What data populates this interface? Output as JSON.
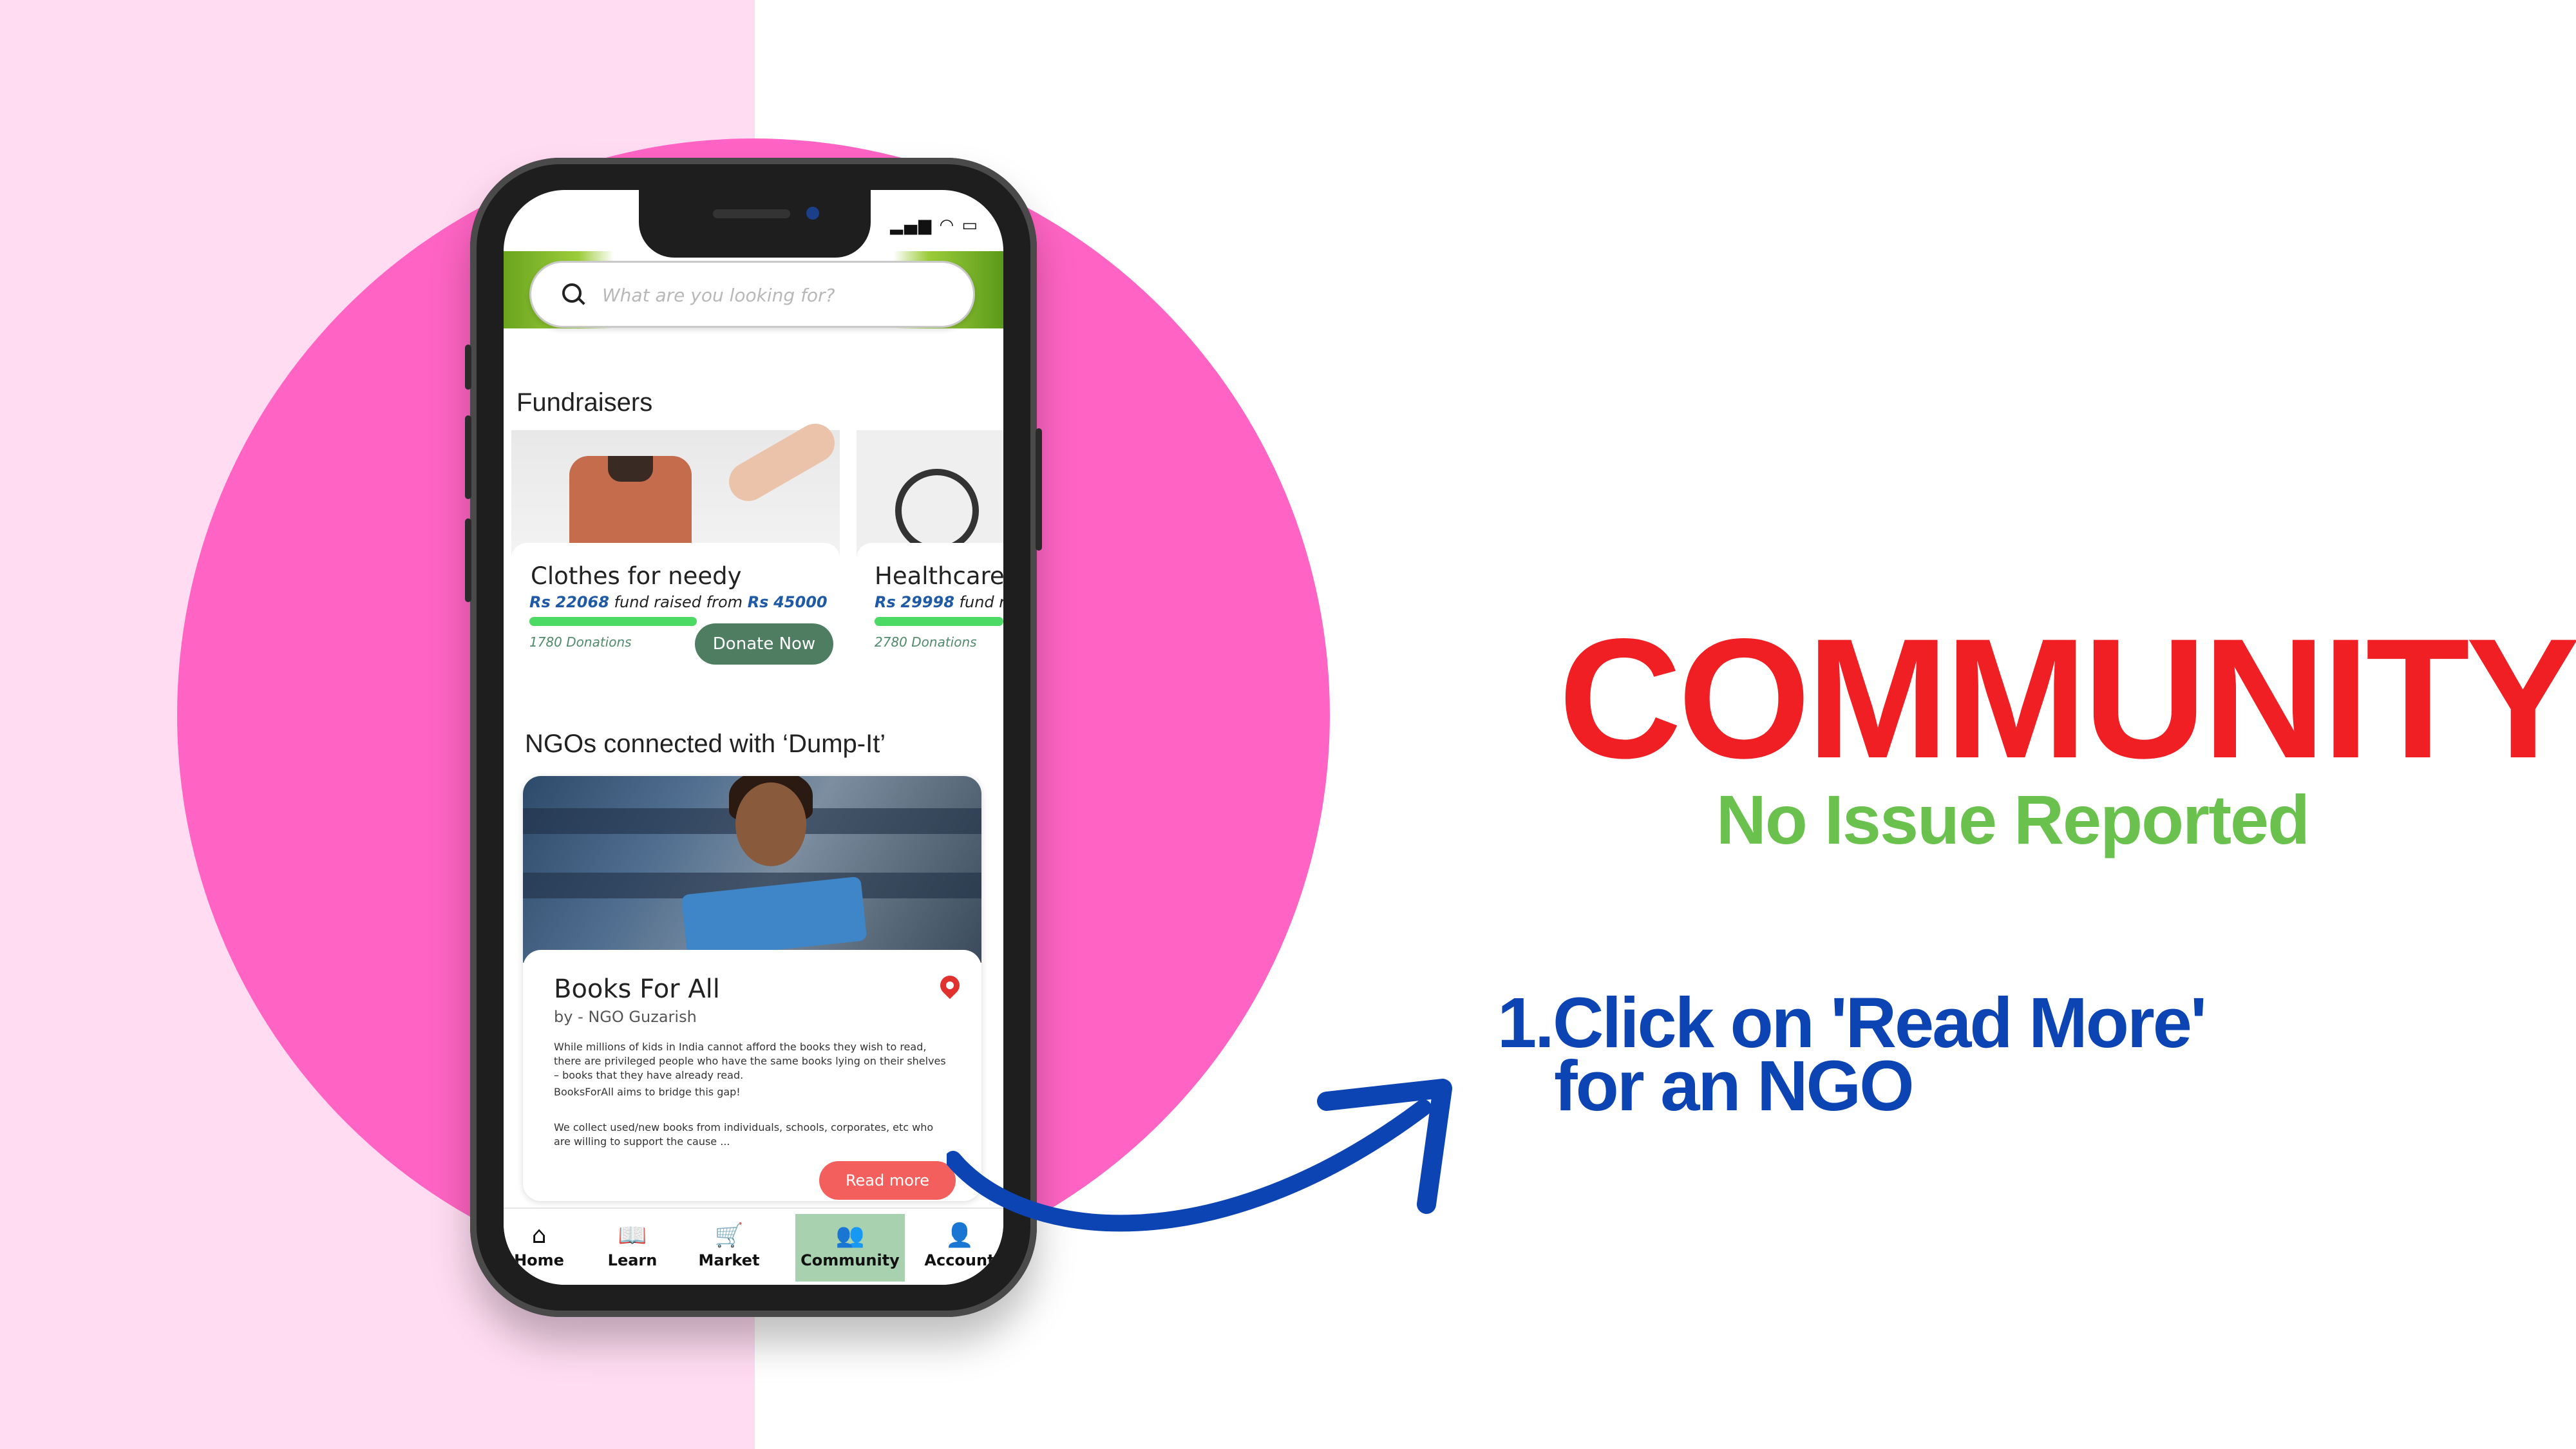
{
  "app": {
    "search": {
      "placeholder": "What are you looking for?"
    },
    "fundraisers": {
      "heading": "Fundraisers",
      "cards": [
        {
          "title": "Clothes for needy",
          "currency": "Rs",
          "raised": "22068",
          "raised_text": "fund raised from",
          "goal": "45000",
          "donations": "1780 Donations",
          "button": "Donate Now"
        },
        {
          "title": "Healthcare",
          "currency": "Rs",
          "raised": "29998",
          "raised_text": "fund ra",
          "donations": "2780 Donations"
        }
      ]
    },
    "ngos": {
      "heading": "NGOs connected with ‘Dump-It’",
      "card": {
        "title": "Books For All",
        "by": "by - NGO Guzarish",
        "desc1": "While millions of kids in India cannot afford the books they wish to read, there are privileged people who have the same books lying on their shelves – books that they have already read.",
        "desc2": "BooksForAll aims to bridge this gap!",
        "desc3": "We collect used/new books from individuals, schools, corporates, etc who are willing to support the cause ...",
        "button": "Read more"
      }
    },
    "nav": [
      {
        "label": "Home",
        "icon": "store-icon"
      },
      {
        "label": "Learn",
        "icon": "book-icon"
      },
      {
        "label": "Market",
        "icon": "cart-icon"
      },
      {
        "label": "Community",
        "icon": "people-icon",
        "active": true
      },
      {
        "label": "Account",
        "icon": "person-icon"
      }
    ]
  },
  "slide": {
    "title": "COMMUNITY",
    "subtitle": "No Issue Reported",
    "step_number": "1.",
    "step_line1": "Click on 'Read More'",
    "step_line2": "for an NGO"
  },
  "colors": {
    "left_panel": "#ffdcf2",
    "circle": "#ff64c4",
    "title_red": "#ef1f24",
    "subtitle_green": "#6ac14d",
    "step_blue": "#0c44b4",
    "donate_green": "#4f7d61",
    "read_more_red": "#f25f5c",
    "nav_active": "#a8d1b0"
  }
}
